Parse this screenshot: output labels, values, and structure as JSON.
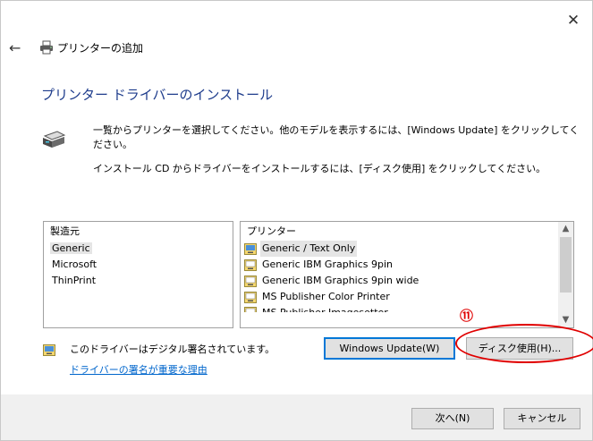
{
  "window": {
    "close_glyph": "✕",
    "back_glyph": "←",
    "header_title": "プリンターの追加"
  },
  "page": {
    "title": "プリンター ドライバーのインストール",
    "description_1": "一覧からプリンターを選択してください。他のモデルを表示するには、[Windows Update] をクリックしてください。",
    "description_2": "インストール CD からドライバーをインストールするには、[ディスク使用] をクリックしてください。"
  },
  "manufacturer_list": {
    "header": "製造元",
    "items": [
      "Generic",
      "Microsoft",
      "ThinPrint"
    ],
    "selected": "Generic"
  },
  "printer_list": {
    "header": "プリンター",
    "items": [
      "Generic / Text Only",
      "Generic IBM Graphics 9pin",
      "Generic IBM Graphics 9pin wide",
      "MS Publisher Color Printer",
      "MS Publisher Imagesetter"
    ],
    "selected": "Generic / Text Only",
    "scroll_up": "▲",
    "scroll_down": "▼"
  },
  "signature": {
    "status": "このドライバーはデジタル署名されています。",
    "link": "ドライバーの署名が重要な理由"
  },
  "buttons": {
    "windows_update": "Windows Update(W)",
    "have_disk": "ディスク使用(H)...",
    "next": "次へ(N)",
    "cancel": "キャンセル"
  },
  "annotation": {
    "number": "⑪",
    "color": "#e00000"
  },
  "colors": {
    "title": "#1e3c8c",
    "link": "#0066cc",
    "focus": "#0078d7"
  }
}
